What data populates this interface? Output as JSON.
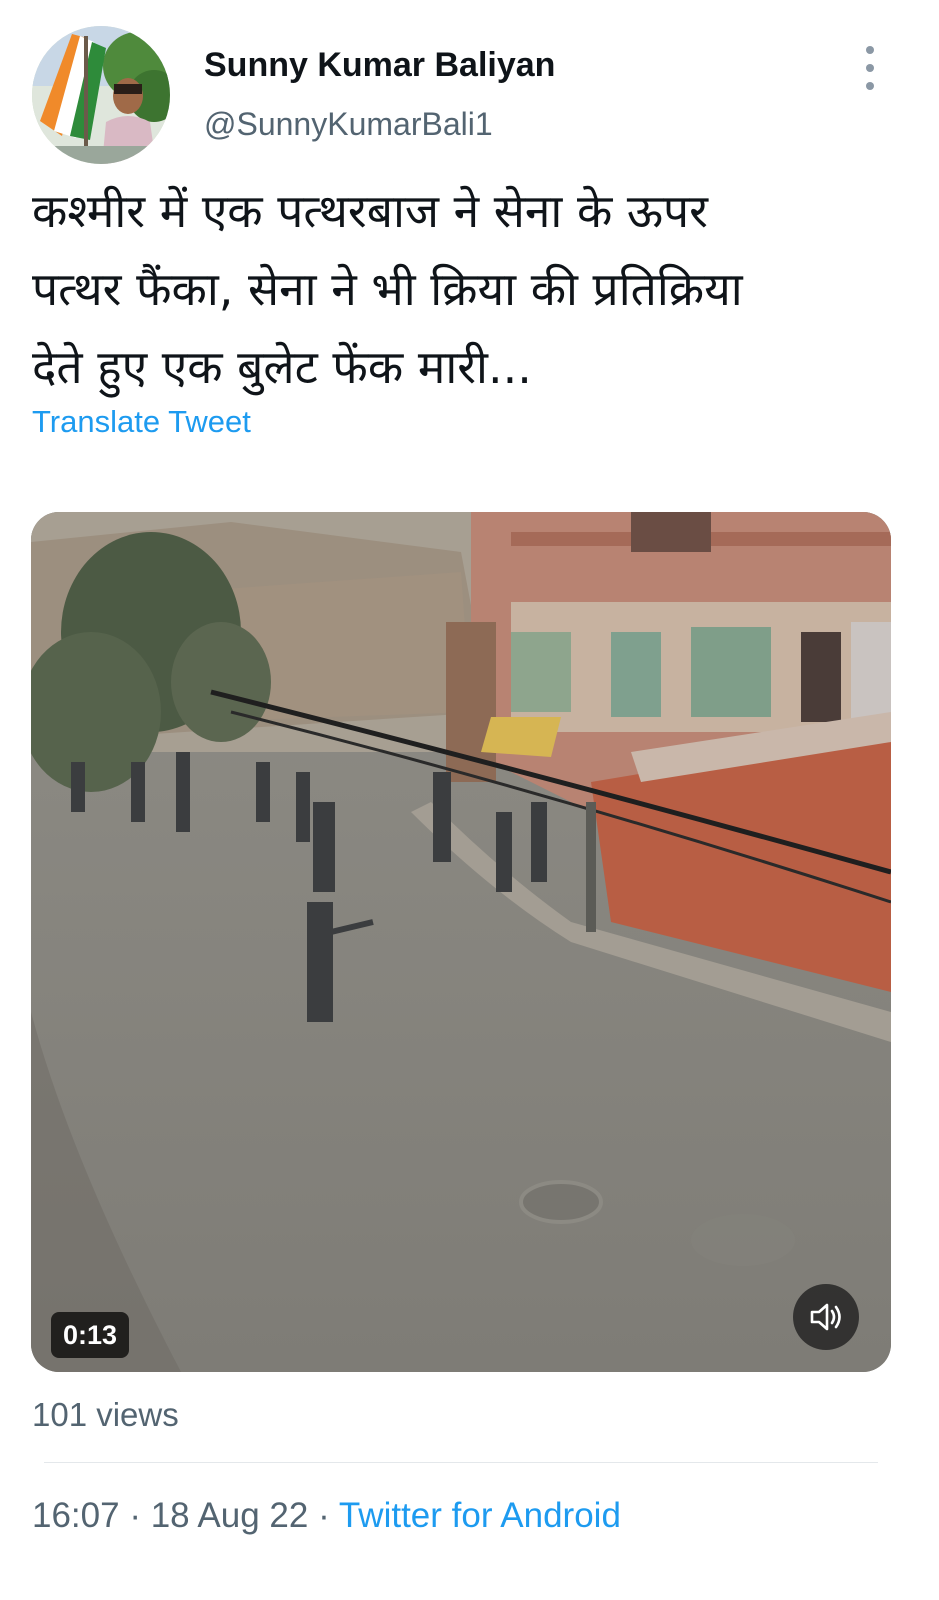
{
  "author": {
    "name": "Sunny Kumar Baliyan",
    "handle": "@SunnyKumarBali1"
  },
  "tweet": {
    "lines": [
      "कश्मीर में एक पत्थरबाज ने सेना के ऊपर",
      "पत्थर फैंका, सेना ने भी क्रिया की प्रतिक्रिया",
      "देते हुए एक बुलेट फेंक मारी..."
    ],
    "translate_label": "Translate Tweet"
  },
  "video": {
    "duration": "0:13",
    "volume_icon": "speaker-muted-icon"
  },
  "stats": {
    "views": "101 views"
  },
  "meta": {
    "time": "16:07",
    "sep1": " · ",
    "date": "18 Aug 22",
    "sep2": " · ",
    "source": "Twitter for Android"
  },
  "colors": {
    "link": "#1d9bf0",
    "secondary_text": "#536471",
    "primary_text": "#0f1419"
  }
}
